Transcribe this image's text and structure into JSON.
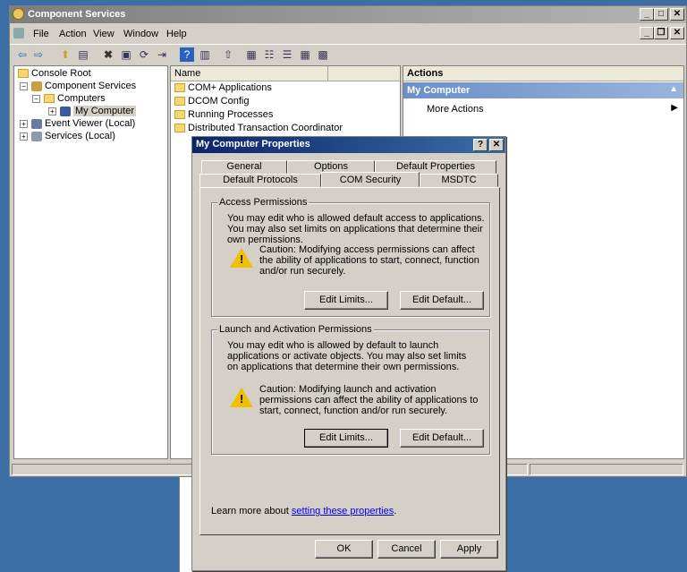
{
  "window": {
    "title": "Component Services",
    "menu": [
      "File",
      "Action",
      "View",
      "Window",
      "Help"
    ]
  },
  "tree": {
    "root": "Console Root",
    "component_services": "Component Services",
    "computers": "Computers",
    "my_computer": "My Computer",
    "event_viewer": "Event Viewer (Local)",
    "services": "Services (Local)"
  },
  "list": {
    "column_name": "Name",
    "items": [
      "COM+ Applications",
      "DCOM Config",
      "Running Processes",
      "Distributed Transaction Coordinator"
    ]
  },
  "actions": {
    "header": "Actions",
    "section": "My Computer",
    "more_actions": "More Actions"
  },
  "dialog": {
    "title": "My Computer Properties",
    "help_button": "?",
    "close_button": "✕",
    "tabs_row1": [
      "General",
      "Options",
      "Default Properties"
    ],
    "tabs_row2": [
      "Default Protocols",
      "COM Security",
      "MSDTC"
    ],
    "selected_tab": "COM Security",
    "access": {
      "label": "Access Permissions",
      "text": "You may edit who is allowed default access to applications. You may also set limits on applications that determine their own permissions.",
      "caution": "Caution: Modifying access permissions can affect the ability of applications to start, connect, function and/or run securely.",
      "edit_limits": "Edit Limits...",
      "edit_default": "Edit Default..."
    },
    "launch": {
      "label": "Launch and Activation Permissions",
      "text": "You may edit who is allowed by default to launch applications or activate objects. You may also set limits on applications that determine their own permissions.",
      "caution": "Caution: Modifying launch and activation permissions can affect the ability of applications to start, connect, function and/or run securely.",
      "edit_limits": "Edit Limits...",
      "edit_default": "Edit Default..."
    },
    "learn_more_prefix": "Learn more about ",
    "learn_more_link": "setting these properties",
    "learn_more_suffix": ".",
    "ok": "OK",
    "cancel": "Cancel",
    "apply": "Apply"
  }
}
